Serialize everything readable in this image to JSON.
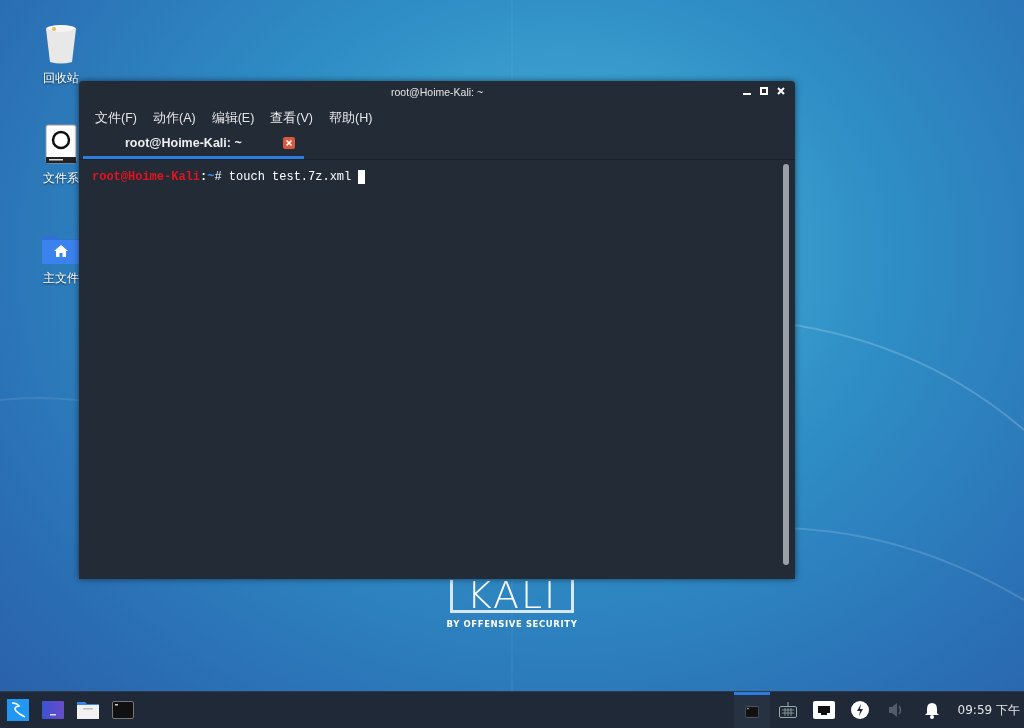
{
  "desktop_icons": [
    {
      "kind": "trash",
      "label": "回收站"
    },
    {
      "kind": "drive",
      "label": "文件系"
    },
    {
      "kind": "home",
      "label": "主文件"
    }
  ],
  "wallpaper": {
    "logo": "KALI",
    "tagline": "BY OFFENSIVE SECURITY"
  },
  "window": {
    "title": "root@Hoime-Kali: ~"
  },
  "menu": [
    "文件(F)",
    "动作(A)",
    "编辑(E)",
    "查看(V)",
    "帮助(H)"
  ],
  "tabs": [
    {
      "label": "root@Hoime-Kali: ~",
      "selected": true
    }
  ],
  "terminal": {
    "lines": [
      {
        "cursor": true,
        "segments": [
          {
            "text": "root@Hoime-Kali",
            "color": "#e0141e"
          },
          {
            "text": ":",
            "color": "#ffffff"
          },
          {
            "text": "~",
            "color": "#3b8eea"
          },
          {
            "text": "# touch test.7z.xml",
            "color": "#ffffff"
          }
        ]
      }
    ]
  },
  "taskbar": {
    "launchers": [
      {
        "kind": "kali-menu"
      },
      {
        "kind": "desktop"
      },
      {
        "kind": "files"
      },
      {
        "kind": "terminal"
      }
    ],
    "tasks": [
      {
        "kind": "terminal",
        "selected": true
      }
    ],
    "tray": [
      {
        "kind": "keyboard"
      },
      {
        "kind": "network"
      },
      {
        "kind": "power"
      },
      {
        "kind": "volume",
        "disabled": true
      },
      {
        "kind": "notifications"
      }
    ],
    "clock": "09:59 下午"
  }
}
